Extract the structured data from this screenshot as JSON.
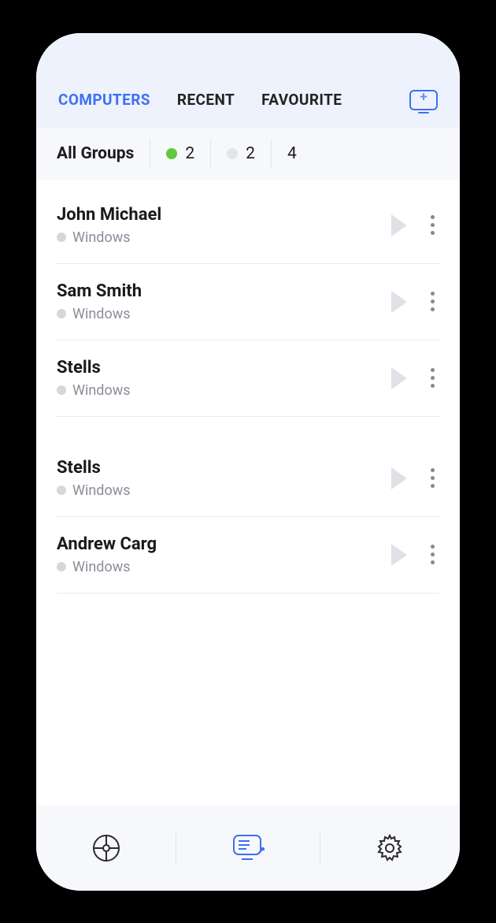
{
  "tabs": {
    "computers": "COMPUTERS",
    "recent": "RECENT",
    "favourite": "FAVOURITE"
  },
  "groups": {
    "title": "All Groups",
    "online_count": "2",
    "offline_count": "2",
    "total": "4"
  },
  "computers": [
    {
      "name": "John Michael",
      "os": "Windows"
    },
    {
      "name": "Sam Smith",
      "os": "Windows"
    },
    {
      "name": "Stells",
      "os": "Windows"
    },
    {
      "name": "Stells",
      "os": "Windows"
    },
    {
      "name": "Andrew Carg",
      "os": "Windows"
    }
  ]
}
